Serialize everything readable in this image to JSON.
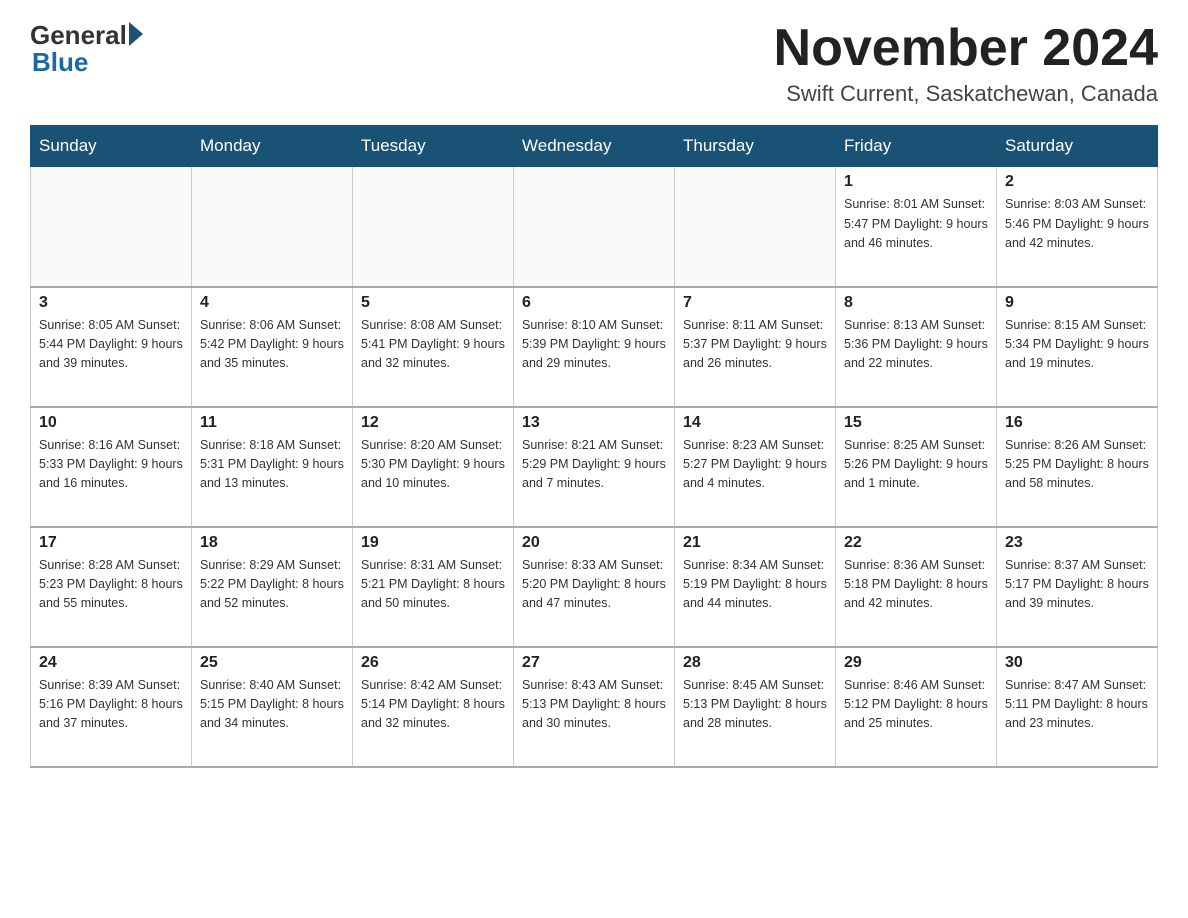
{
  "logo": {
    "text_general": "General",
    "text_blue": "Blue"
  },
  "header": {
    "month_year": "November 2024",
    "location": "Swift Current, Saskatchewan, Canada"
  },
  "days_of_week": [
    "Sunday",
    "Monday",
    "Tuesday",
    "Wednesday",
    "Thursday",
    "Friday",
    "Saturday"
  ],
  "weeks": [
    [
      {
        "day": "",
        "info": ""
      },
      {
        "day": "",
        "info": ""
      },
      {
        "day": "",
        "info": ""
      },
      {
        "day": "",
        "info": ""
      },
      {
        "day": "",
        "info": ""
      },
      {
        "day": "1",
        "info": "Sunrise: 8:01 AM\nSunset: 5:47 PM\nDaylight: 9 hours and 46 minutes."
      },
      {
        "day": "2",
        "info": "Sunrise: 8:03 AM\nSunset: 5:46 PM\nDaylight: 9 hours and 42 minutes."
      }
    ],
    [
      {
        "day": "3",
        "info": "Sunrise: 8:05 AM\nSunset: 5:44 PM\nDaylight: 9 hours and 39 minutes."
      },
      {
        "day": "4",
        "info": "Sunrise: 8:06 AM\nSunset: 5:42 PM\nDaylight: 9 hours and 35 minutes."
      },
      {
        "day": "5",
        "info": "Sunrise: 8:08 AM\nSunset: 5:41 PM\nDaylight: 9 hours and 32 minutes."
      },
      {
        "day": "6",
        "info": "Sunrise: 8:10 AM\nSunset: 5:39 PM\nDaylight: 9 hours and 29 minutes."
      },
      {
        "day": "7",
        "info": "Sunrise: 8:11 AM\nSunset: 5:37 PM\nDaylight: 9 hours and 26 minutes."
      },
      {
        "day": "8",
        "info": "Sunrise: 8:13 AM\nSunset: 5:36 PM\nDaylight: 9 hours and 22 minutes."
      },
      {
        "day": "9",
        "info": "Sunrise: 8:15 AM\nSunset: 5:34 PM\nDaylight: 9 hours and 19 minutes."
      }
    ],
    [
      {
        "day": "10",
        "info": "Sunrise: 8:16 AM\nSunset: 5:33 PM\nDaylight: 9 hours and 16 minutes."
      },
      {
        "day": "11",
        "info": "Sunrise: 8:18 AM\nSunset: 5:31 PM\nDaylight: 9 hours and 13 minutes."
      },
      {
        "day": "12",
        "info": "Sunrise: 8:20 AM\nSunset: 5:30 PM\nDaylight: 9 hours and 10 minutes."
      },
      {
        "day": "13",
        "info": "Sunrise: 8:21 AM\nSunset: 5:29 PM\nDaylight: 9 hours and 7 minutes."
      },
      {
        "day": "14",
        "info": "Sunrise: 8:23 AM\nSunset: 5:27 PM\nDaylight: 9 hours and 4 minutes."
      },
      {
        "day": "15",
        "info": "Sunrise: 8:25 AM\nSunset: 5:26 PM\nDaylight: 9 hours and 1 minute."
      },
      {
        "day": "16",
        "info": "Sunrise: 8:26 AM\nSunset: 5:25 PM\nDaylight: 8 hours and 58 minutes."
      }
    ],
    [
      {
        "day": "17",
        "info": "Sunrise: 8:28 AM\nSunset: 5:23 PM\nDaylight: 8 hours and 55 minutes."
      },
      {
        "day": "18",
        "info": "Sunrise: 8:29 AM\nSunset: 5:22 PM\nDaylight: 8 hours and 52 minutes."
      },
      {
        "day": "19",
        "info": "Sunrise: 8:31 AM\nSunset: 5:21 PM\nDaylight: 8 hours and 50 minutes."
      },
      {
        "day": "20",
        "info": "Sunrise: 8:33 AM\nSunset: 5:20 PM\nDaylight: 8 hours and 47 minutes."
      },
      {
        "day": "21",
        "info": "Sunrise: 8:34 AM\nSunset: 5:19 PM\nDaylight: 8 hours and 44 minutes."
      },
      {
        "day": "22",
        "info": "Sunrise: 8:36 AM\nSunset: 5:18 PM\nDaylight: 8 hours and 42 minutes."
      },
      {
        "day": "23",
        "info": "Sunrise: 8:37 AM\nSunset: 5:17 PM\nDaylight: 8 hours and 39 minutes."
      }
    ],
    [
      {
        "day": "24",
        "info": "Sunrise: 8:39 AM\nSunset: 5:16 PM\nDaylight: 8 hours and 37 minutes."
      },
      {
        "day": "25",
        "info": "Sunrise: 8:40 AM\nSunset: 5:15 PM\nDaylight: 8 hours and 34 minutes."
      },
      {
        "day": "26",
        "info": "Sunrise: 8:42 AM\nSunset: 5:14 PM\nDaylight: 8 hours and 32 minutes."
      },
      {
        "day": "27",
        "info": "Sunrise: 8:43 AM\nSunset: 5:13 PM\nDaylight: 8 hours and 30 minutes."
      },
      {
        "day": "28",
        "info": "Sunrise: 8:45 AM\nSunset: 5:13 PM\nDaylight: 8 hours and 28 minutes."
      },
      {
        "day": "29",
        "info": "Sunrise: 8:46 AM\nSunset: 5:12 PM\nDaylight: 8 hours and 25 minutes."
      },
      {
        "day": "30",
        "info": "Sunrise: 8:47 AM\nSunset: 5:11 PM\nDaylight: 8 hours and 23 minutes."
      }
    ]
  ]
}
